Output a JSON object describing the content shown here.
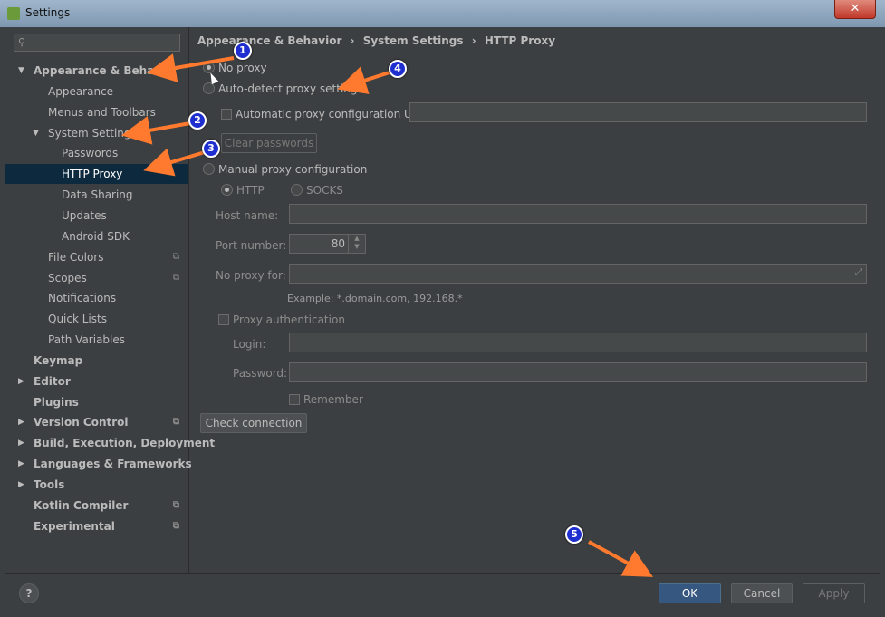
{
  "window": {
    "title": "Settings",
    "close": "✕"
  },
  "search": {
    "icon": "search-icon",
    "placeholder": ""
  },
  "sidebar": {
    "items": [
      {
        "label": "Appearance & Behavior",
        "bold": true,
        "arrow": "▼"
      },
      {
        "label": "Appearance"
      },
      {
        "label": "Menus and Toolbars"
      },
      {
        "label": "System Settings",
        "arrow": "▼"
      },
      {
        "label": "Passwords"
      },
      {
        "label": "HTTP Proxy",
        "selected": true
      },
      {
        "label": "Data Sharing"
      },
      {
        "label": "Updates"
      },
      {
        "label": "Android SDK"
      },
      {
        "label": "File Colors",
        "copy_icon": true
      },
      {
        "label": "Scopes",
        "copy_icon": true
      },
      {
        "label": "Notifications"
      },
      {
        "label": "Quick Lists"
      },
      {
        "label": "Path Variables"
      },
      {
        "label": "Keymap",
        "bold": true
      },
      {
        "label": "Editor",
        "bold": true,
        "arrow": "▶"
      },
      {
        "label": "Plugins",
        "bold": true
      },
      {
        "label": "Version Control",
        "bold": true,
        "arrow": "▶",
        "copy_icon": true
      },
      {
        "label": "Build, Execution, Deployment",
        "bold": true,
        "arrow": "▶"
      },
      {
        "label": "Languages & Frameworks",
        "bold": true,
        "arrow": "▶"
      },
      {
        "label": "Tools",
        "bold": true,
        "arrow": "▶"
      },
      {
        "label": "Kotlin Compiler",
        "bold": true,
        "copy_icon": true
      },
      {
        "label": "Experimental",
        "bold": true,
        "copy_icon": true
      }
    ]
  },
  "breadcrumb": {
    "part1": "Appearance & Behavior",
    "sep": "›",
    "part2": "System Settings",
    "part3": "HTTP Proxy"
  },
  "proxy": {
    "no_proxy": "No proxy",
    "auto_detect": "Auto-detect proxy settings",
    "auto_config_url": "Automatic proxy configuration URL:",
    "clear_passwords": "Clear passwords",
    "manual": "Manual proxy configuration",
    "http": "HTTP",
    "socks": "SOCKS",
    "host_name": "Host name:",
    "port_number": "Port number:",
    "port_value": "80",
    "no_proxy_for": "No proxy for:",
    "example": "Example: *.domain.com, 192.168.*",
    "proxy_auth": "Proxy authentication",
    "login": "Login:",
    "password": "Password:",
    "remember": "Remember",
    "check_connection": "Check connection"
  },
  "footer": {
    "help": "?",
    "ok": "OK",
    "cancel": "Cancel",
    "apply": "Apply"
  },
  "annotations": {
    "b1": "1",
    "b2": "2",
    "b3": "3",
    "b4": "4",
    "b5": "5"
  },
  "colors": {
    "accent": "#365880",
    "selection": "#0d293e",
    "arrow": "#ff7a2e",
    "badge": "#1f2fcf"
  }
}
